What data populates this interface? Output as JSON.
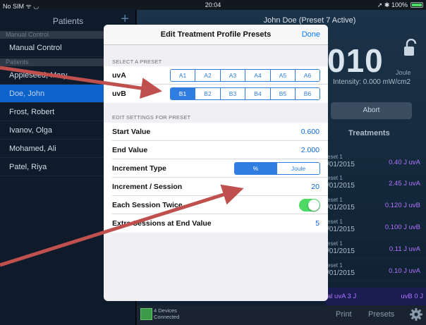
{
  "status_bar": {
    "carrier": "No SIM ᯤ ◡",
    "time": "20:04",
    "battery": "➚ ✱ 100%"
  },
  "sidebar": {
    "title": "Patients",
    "add": "+",
    "section_manual": "Manual Control",
    "manual_item": "Manual Control",
    "section_patients": "Patients",
    "patients": [
      "Appleseed, Mary",
      "Doe, John",
      "Frost, Robert",
      "Ivanov, Olga",
      "Mohamed, Ali",
      "Patel, Riya"
    ]
  },
  "main": {
    "title": "John Doe (Preset 7 Active)",
    "dose_value": "010",
    "dose_unit": "Joule",
    "intensity": "Intensity: 0.000 mW/cm2",
    "abort_label": "Abort",
    "treatments_header": "Treatments",
    "treatments": [
      {
        "preset": "eset 1",
        "date": "/01/2015",
        "value": "0.40 J uvA"
      },
      {
        "preset": "eset 1",
        "date": "/01/2015",
        "value": "2.45 J uvA"
      },
      {
        "preset": "eset 1",
        "date": "/01/2015",
        "value": "0.120 J uvB"
      },
      {
        "preset": "eset 1",
        "date": "/01/2015",
        "value": "0.100 J uvB"
      },
      {
        "preset": "eset 1",
        "date": "/01/2015",
        "value": "0.11 J uvA"
      },
      {
        "preset": "eset 1",
        "date": "/01/2015",
        "value": "0.10 J uvA"
      }
    ],
    "total_uva": "al uvA 3 J",
    "total_uvb": "uvB 0 J"
  },
  "bottom_bar": {
    "devices_line1": "4 Devices",
    "devices_line2": "Connected",
    "print": "Print",
    "presets": "Presets"
  },
  "modal": {
    "title": "Edit Treatment Profile Presets",
    "done": "Done",
    "select_header": "SELECT A PRESET",
    "uva_label": "uvA",
    "uva_options": [
      "A1",
      "A2",
      "A3",
      "A4",
      "A5",
      "A6"
    ],
    "uvb_label": "uvB",
    "uvb_options": [
      "B1",
      "B2",
      "B3",
      "B4",
      "B5",
      "B6"
    ],
    "uvb_selected": "B1",
    "edit_header": "EDIT SETTINGS FOR PRESET",
    "start_label": "Start Value",
    "start_value": "0.600",
    "end_label": "End Value",
    "end_value": "2.000",
    "increment_type_label": "Increment Type",
    "increment_types": [
      "%",
      "Joule"
    ],
    "increment_type_selected": "%",
    "increment_label": "Increment / Session",
    "increment_value": "20",
    "twice_label": "Each Session Twice",
    "twice_on": true,
    "extra_label": "Extra Sessions at End Value",
    "extra_value": "5"
  },
  "colors": {
    "accent": "#0a7aff",
    "segment": "#2f7de0",
    "arrow": "#c0504d",
    "toggle_on": "#4cd964",
    "uv_text": "#b273ff"
  }
}
